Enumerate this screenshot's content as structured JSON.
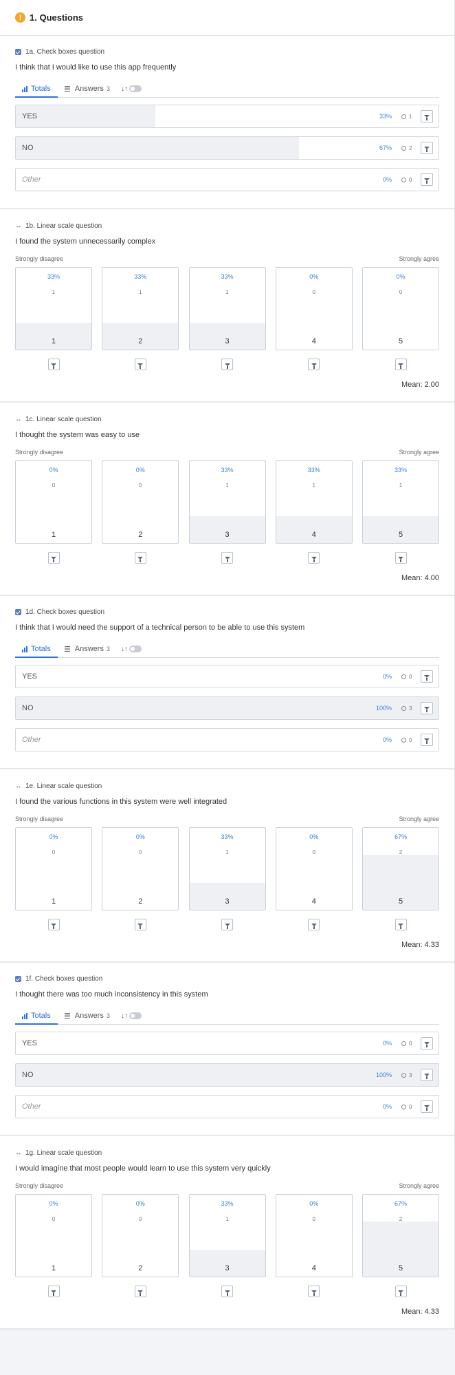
{
  "header": {
    "icon": "warning-icon",
    "title": "1. Questions"
  },
  "labels": {
    "tab_totals": "Totals",
    "tab_answers": "Answers",
    "scale_left": "Strongly disagree",
    "scale_right": "Strongly agree"
  },
  "questions": [
    {
      "kind": "checkbox",
      "type_label": "1a. Check boxes question",
      "text": "I think that I would like to use this app frequently",
      "answers_count": "3",
      "options": [
        {
          "label": "YES",
          "pct": "33%",
          "count": "1",
          "fraction": 0.33,
          "other": false
        },
        {
          "label": "NO",
          "pct": "67%",
          "count": "2",
          "fraction": 0.67,
          "other": false
        },
        {
          "label": "Other",
          "pct": "0%",
          "count": "0",
          "fraction": 0,
          "other": true
        }
      ]
    },
    {
      "kind": "scale",
      "type_label": "1b. Linear scale question",
      "text": "I found the system unnecessarily complex",
      "columns": [
        {
          "num": "1",
          "pct": "33%",
          "count": "1",
          "fraction": 0.33
        },
        {
          "num": "2",
          "pct": "33%",
          "count": "1",
          "fraction": 0.33
        },
        {
          "num": "3",
          "pct": "33%",
          "count": "1",
          "fraction": 0.33
        },
        {
          "num": "4",
          "pct": "0%",
          "count": "0",
          "fraction": 0
        },
        {
          "num": "5",
          "pct": "0%",
          "count": "0",
          "fraction": 0
        }
      ],
      "mean": "Mean: 2.00"
    },
    {
      "kind": "scale",
      "type_label": "1c. Linear scale question",
      "text": "I thought the system was easy to use",
      "columns": [
        {
          "num": "1",
          "pct": "0%",
          "count": "0",
          "fraction": 0
        },
        {
          "num": "2",
          "pct": "0%",
          "count": "0",
          "fraction": 0
        },
        {
          "num": "3",
          "pct": "33%",
          "count": "1",
          "fraction": 0.33
        },
        {
          "num": "4",
          "pct": "33%",
          "count": "1",
          "fraction": 0.33
        },
        {
          "num": "5",
          "pct": "33%",
          "count": "1",
          "fraction": 0.33
        }
      ],
      "mean": "Mean: 4.00"
    },
    {
      "kind": "checkbox",
      "type_label": "1d. Check boxes question",
      "text": "I think that I would need the support of a technical person to be able to use this system",
      "answers_count": "3",
      "options": [
        {
          "label": "YES",
          "pct": "0%",
          "count": "0",
          "fraction": 0,
          "other": false
        },
        {
          "label": "NO",
          "pct": "100%",
          "count": "3",
          "fraction": 1,
          "other": false
        },
        {
          "label": "Other",
          "pct": "0%",
          "count": "0",
          "fraction": 0,
          "other": true
        }
      ]
    },
    {
      "kind": "scale",
      "type_label": "1e. Linear scale question",
      "text": "I found the various functions in this system were well integrated",
      "columns": [
        {
          "num": "1",
          "pct": "0%",
          "count": "0",
          "fraction": 0
        },
        {
          "num": "2",
          "pct": "0%",
          "count": "0",
          "fraction": 0
        },
        {
          "num": "3",
          "pct": "33%",
          "count": "1",
          "fraction": 0.33
        },
        {
          "num": "4",
          "pct": "0%",
          "count": "0",
          "fraction": 0
        },
        {
          "num": "5",
          "pct": "67%",
          "count": "2",
          "fraction": 0.67
        }
      ],
      "mean": "Mean: 4.33"
    },
    {
      "kind": "checkbox",
      "type_label": "1f. Check boxes question",
      "text": "I thought there was too much inconsistency in this system",
      "answers_count": "3",
      "options": [
        {
          "label": "YES",
          "pct": "0%",
          "count": "0",
          "fraction": 0,
          "other": false
        },
        {
          "label": "NO",
          "pct": "100%",
          "count": "3",
          "fraction": 1,
          "other": false
        },
        {
          "label": "Other",
          "pct": "0%",
          "count": "0",
          "fraction": 0,
          "other": true
        }
      ]
    },
    {
      "kind": "scale",
      "type_label": "1g. Linear scale question",
      "text": "I would imagine that most people would learn to use this system very quickly",
      "columns": [
        {
          "num": "1",
          "pct": "0%",
          "count": "0",
          "fraction": 0
        },
        {
          "num": "2",
          "pct": "0%",
          "count": "0",
          "fraction": 0
        },
        {
          "num": "3",
          "pct": "33%",
          "count": "1",
          "fraction": 0.33
        },
        {
          "num": "4",
          "pct": "0%",
          "count": "0",
          "fraction": 0
        },
        {
          "num": "5",
          "pct": "67%",
          "count": "2",
          "fraction": 0.67
        }
      ],
      "mean": "Mean: 4.33"
    }
  ],
  "colors": {
    "accent": "#2f6fd6",
    "percent": "#3b82d6",
    "fill": "#eef0f4",
    "warning": "#f3a531",
    "border": "#d4d7de"
  }
}
